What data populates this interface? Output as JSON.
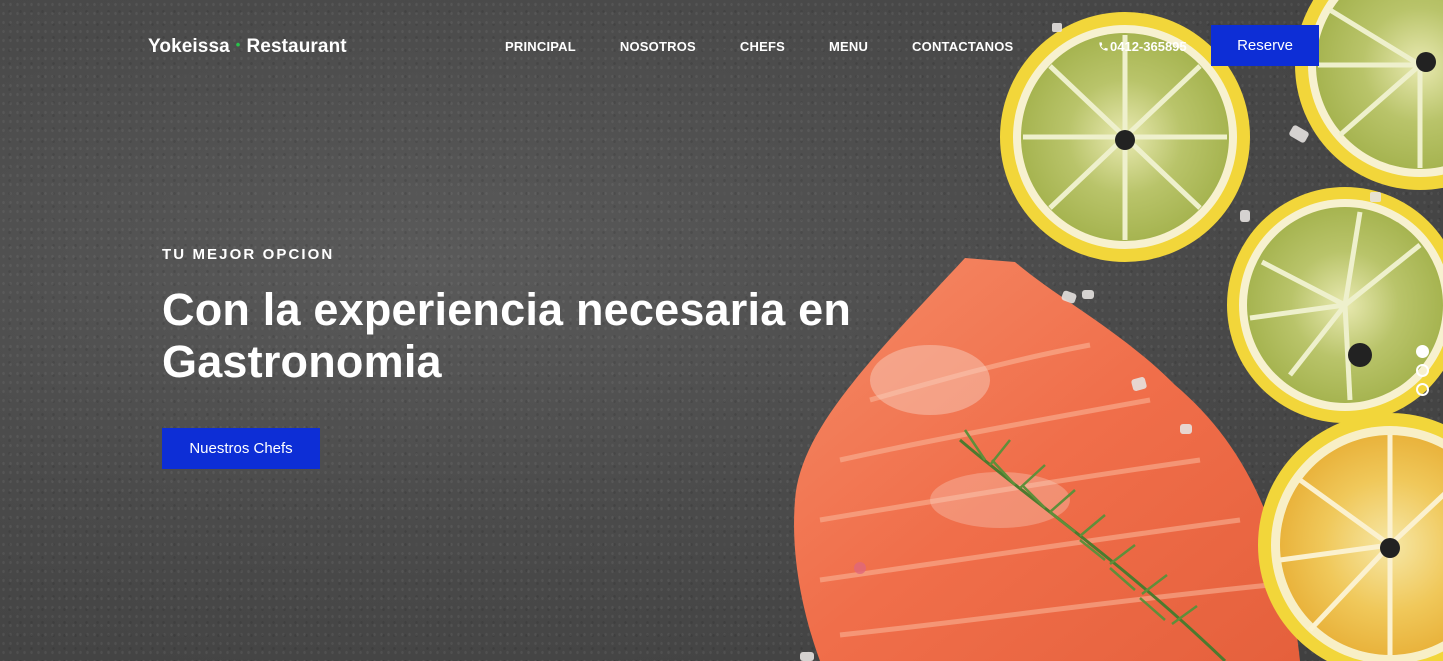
{
  "brand": {
    "name_left": "Yokeissa",
    "separator": "•",
    "name_right": "Restaurant",
    "accent_color": "#28c24a"
  },
  "nav": {
    "items": [
      "PRINCIPAL",
      "NOSOTROS",
      "CHEFS",
      "MENU",
      "CONTACTANOS"
    ]
  },
  "contact": {
    "phone": "0412-365895",
    "icon": "phone-icon"
  },
  "header": {
    "reserve_label": "Reserve",
    "button_color": "#0d2ed6"
  },
  "hero": {
    "eyebrow": "TU MEJOR OPCION",
    "headline_line1": "Con la experiencia necesaria en",
    "headline_line2": "Gastronomia",
    "cta_label": "Nuestros Chefs"
  },
  "slider": {
    "total": 3,
    "active_index": 0
  }
}
